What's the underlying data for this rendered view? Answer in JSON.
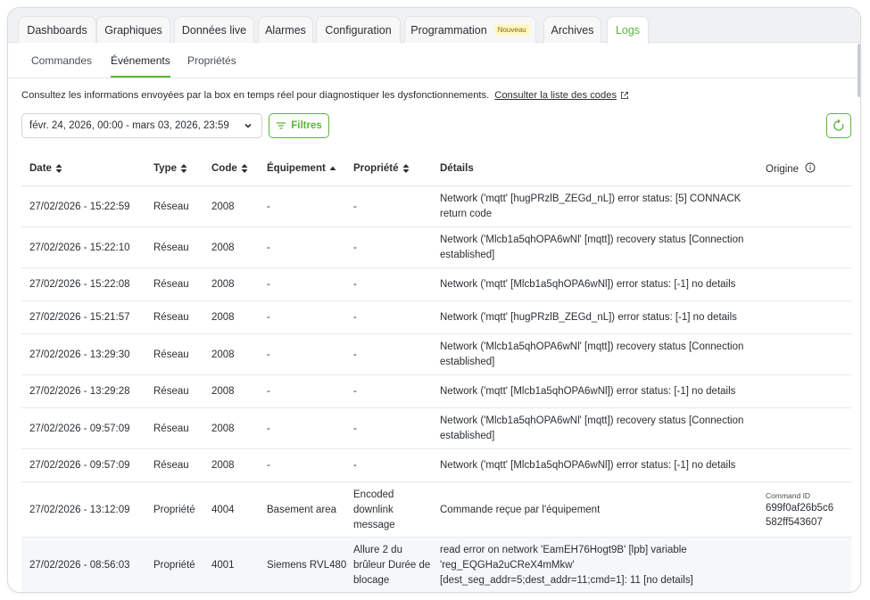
{
  "tabs": [
    {
      "label": "Dashboards",
      "active": false
    },
    {
      "label": "Graphiques",
      "active": false
    },
    {
      "label": "Données live",
      "active": false
    },
    {
      "label": "Alarmes",
      "active": false
    },
    {
      "label": "Configuration",
      "active": false
    },
    {
      "label": "Programmation",
      "badge": "Nouveau",
      "active": false
    },
    {
      "label": "Archives",
      "active": false
    },
    {
      "label": "Logs",
      "active": true
    }
  ],
  "subtabs": [
    {
      "label": "Commandes",
      "active": false
    },
    {
      "label": "Événements",
      "active": true
    },
    {
      "label": "Propriétés",
      "active": false
    }
  ],
  "description": {
    "text": "Consultez les informations envoyées par la box en temps réel pour diagnostiquer les dysfonctionnements.",
    "link": "Consulter la liste des codes"
  },
  "toolbar": {
    "date_range": "févr. 24, 2026, 00:00 - mars 03, 2026, 23:59",
    "filters_label": "Filtres"
  },
  "table": {
    "headers": {
      "date": "Date",
      "type": "Type",
      "code": "Code",
      "equipment": "Équipement",
      "property": "Propriété",
      "details": "Détails",
      "origin": "Origine"
    },
    "rows": [
      {
        "date": "27/02/2026 - 15:22:59",
        "type": "Réseau",
        "code": "2008",
        "equipment": "-",
        "property": "-",
        "details": "Network ('mqtt' [hugPRzlB_ZEGd_nL]) error status: [5] CONNACK return code",
        "origin_label": "",
        "origin_value": ""
      },
      {
        "date": "27/02/2026 - 15:22:10",
        "type": "Réseau",
        "code": "2008",
        "equipment": "-",
        "property": "-",
        "details": "Network ('Mlcb1a5qhOPA6wNl' [mqtt]) recovery status [Connection established]",
        "origin_label": "",
        "origin_value": ""
      },
      {
        "date": "27/02/2026 - 15:22:08",
        "type": "Réseau",
        "code": "2008",
        "equipment": "-",
        "property": "-",
        "details": "Network ('mqtt' [Mlcb1a5qhOPA6wNl]) error status: [-1] no details",
        "origin_label": "",
        "origin_value": ""
      },
      {
        "date": "27/02/2026 - 15:21:57",
        "type": "Réseau",
        "code": "2008",
        "equipment": "-",
        "property": "-",
        "details": "Network ('mqtt' [hugPRzlB_ZEGd_nL]) error status: [-1] no details",
        "origin_label": "",
        "origin_value": ""
      },
      {
        "date": "27/02/2026 - 13:29:30",
        "type": "Réseau",
        "code": "2008",
        "equipment": "-",
        "property": "-",
        "details": "Network ('Mlcb1a5qhOPA6wNl' [mqtt]) recovery status [Connection established]",
        "origin_label": "",
        "origin_value": ""
      },
      {
        "date": "27/02/2026 - 13:29:28",
        "type": "Réseau",
        "code": "2008",
        "equipment": "-",
        "property": "-",
        "details": "Network ('mqtt' [Mlcb1a5qhOPA6wNl]) error status: [-1] no details",
        "origin_label": "",
        "origin_value": ""
      },
      {
        "date": "27/02/2026 - 09:57:09",
        "type": "Réseau",
        "code": "2008",
        "equipment": "-",
        "property": "-",
        "details": "Network ('Mlcb1a5qhOPA6wNl' [mqtt]) recovery status [Connection established]",
        "origin_label": "",
        "origin_value": ""
      },
      {
        "date": "27/02/2026 - 09:57:09",
        "type": "Réseau",
        "code": "2008",
        "equipment": "-",
        "property": "-",
        "details": "Network ('mqtt' [Mlcb1a5qhOPA6wNl]) error status: [-1] no details",
        "origin_label": "",
        "origin_value": ""
      },
      {
        "date": "27/02/2026 - 13:12:09",
        "type": "Propriété",
        "code": "4004",
        "equipment": "Basement area",
        "property": "Encoded downlink message",
        "details": "Commande reçue par l'équipement",
        "origin_label": "Command ID",
        "origin_value": "699f0af26b5c6582ff543607"
      },
      {
        "date": "27/02/2026 - 08:56:03",
        "type": "Propriété",
        "code": "4001",
        "equipment": "Siemens RVL480",
        "property": "Allure 2 du brûleur Durée de blocage",
        "details": "read error on network 'EamEH76Hogt9B' [lpb] variable 'reg_EQGHa2uCReX4mMkw' [dest_seg_addr=5;dest_addr=11;cmd=1]: 11 [no details]",
        "origin_label": "",
        "origin_value": ""
      }
    ]
  },
  "colors": {
    "accent": "#5bb43c",
    "badge_bg": "#fff6c8",
    "badge_text": "#8a6d00"
  }
}
